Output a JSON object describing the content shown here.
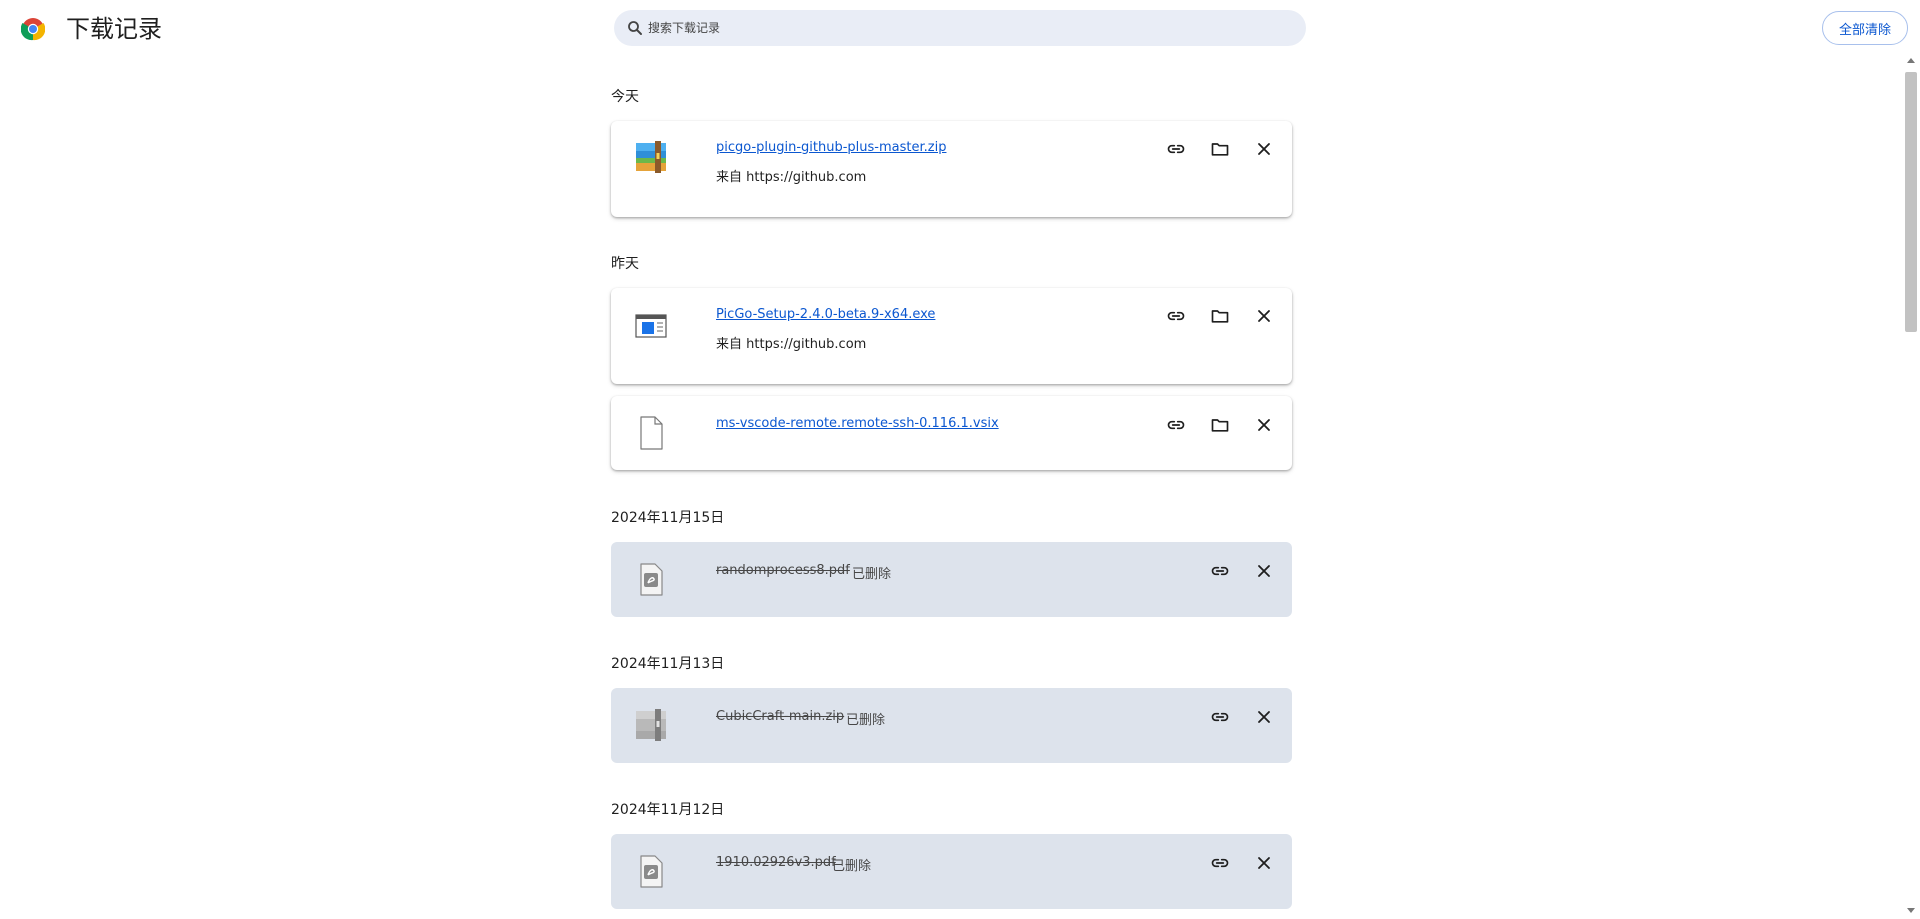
{
  "header": {
    "title": "下载记录",
    "search_placeholder": "搜索下载记录",
    "clear_all_label": "全部清除"
  },
  "groups": [
    {
      "date": "今天",
      "items": [
        {
          "name": "picgo-plugin-github-plus-master.zip",
          "source": "来自 https://github.com",
          "icon": "zip-archive-icon",
          "status": ""
        }
      ]
    },
    {
      "date": "昨天",
      "items": [
        {
          "name": "PicGo-Setup-2.4.0-beta.9-x64.exe",
          "source": "来自 https://github.com",
          "icon": "exe-window-icon",
          "status": ""
        },
        {
          "name": "ms-vscode-remote.remote-ssh-0.116.1.vsix",
          "source": "",
          "icon": "blank-file-icon",
          "status": ""
        }
      ]
    },
    {
      "date": "2024年11月15日",
      "items": [
        {
          "name": "randomprocess8.pdf",
          "source": "",
          "icon": "pdf-file-icon",
          "status": "已删除"
        }
      ]
    },
    {
      "date": "2024年11月13日",
      "items": [
        {
          "name": "CubicCraft-main.zip",
          "source": "",
          "icon": "zip-archive-icon",
          "status": "已删除"
        }
      ]
    },
    {
      "date": "2024年11月12日",
      "items": [
        {
          "name": "1910.02926v3.pdf",
          "source": "",
          "icon": "pdf-file-icon",
          "status": "已删除"
        }
      ]
    }
  ],
  "colors": {
    "link": "#0b57d0",
    "deleted_card_bg": "#dde3ec",
    "search_bg": "#e9edf6"
  }
}
